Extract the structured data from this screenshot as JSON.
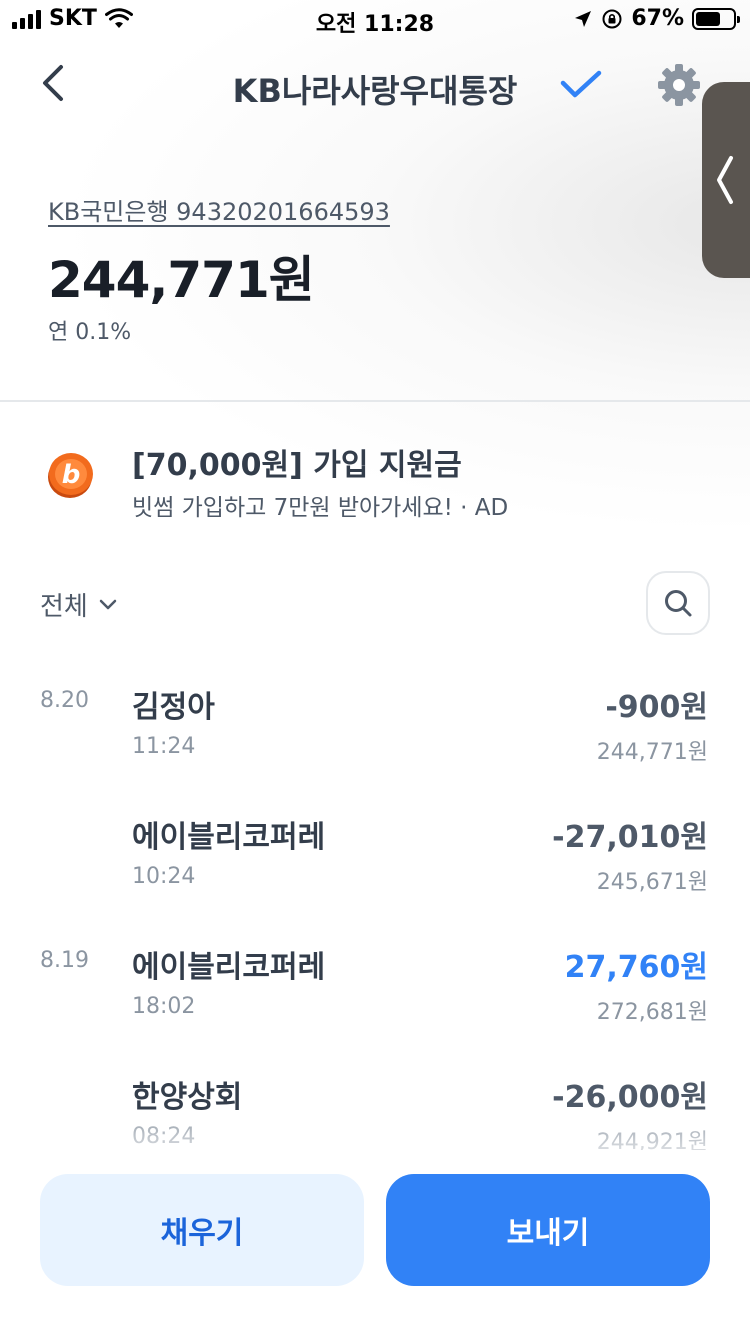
{
  "status_bar": {
    "carrier": "SKT",
    "time": "오전 11:28",
    "battery_percent": "67%",
    "battery_level": 0.67
  },
  "nav": {
    "title": "KB나라사랑우대통장",
    "icons": [
      "chevron-left-icon",
      "check-icon",
      "gear-icon",
      "chevron-left-icon"
    ]
  },
  "account": {
    "bank_and_number": "KB국민은행 94320201664593",
    "balance": "244,771원",
    "interest_rate": "연 0.1%"
  },
  "ad": {
    "title": "[70,000원] 가입 지원금",
    "subtitle": "빗썸 가입하고 7만원 받아가세요! · AD",
    "coin_letter": "b"
  },
  "filter": {
    "label": "전체",
    "icons": [
      "chevron-down-icon",
      "search-icon"
    ]
  },
  "transactions": [
    {
      "date": "8.20",
      "name": "김정아",
      "time": "11:24",
      "amount": "-900원",
      "balance": "244,771원",
      "type": "debit"
    },
    {
      "date": "",
      "name": "에이블리코퍼레",
      "time": "10:24",
      "amount": "-27,010원",
      "balance": "245,671원",
      "type": "debit"
    },
    {
      "date": "8.19",
      "name": "에이블리코퍼레",
      "time": "18:02",
      "amount": "27,760원",
      "balance": "272,681원",
      "type": "credit"
    },
    {
      "date": "",
      "name": "한양상회",
      "time": "08:24",
      "amount": "-26,000원",
      "balance": "244,921원",
      "type": "debit"
    }
  ],
  "buttons": {
    "fill_label": "채우기",
    "send_label": "보내기"
  },
  "colors": {
    "accent": "#3182f6",
    "fill_button_bg": "#e8f3ff",
    "text_primary": "#191f28",
    "text_secondary": "#8b95a1",
    "coin_orange": "#f26b1d"
  }
}
